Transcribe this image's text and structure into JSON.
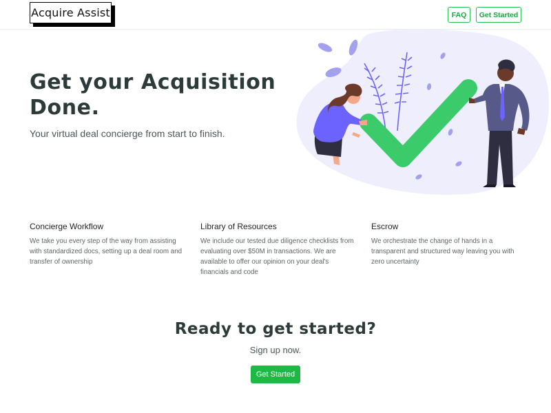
{
  "nav": {
    "logo": "Acquire Assist",
    "faq_label": "FAQ",
    "get_started_label": "Get Started"
  },
  "hero": {
    "title": "Get your Acquisition Done.",
    "subtitle": "Your virtual deal concierge from start to finish."
  },
  "features": [
    {
      "title": "Concierge Workflow",
      "description": "We take you every step of the way from assisting with standardized docs, setting up a deal room and transfer of ownership"
    },
    {
      "title": "Library of Resources",
      "description": "We include our tested due diligence checklists from evaluating over $50M in transactions. We are available to offer our opinion on your deal's financials and code"
    },
    {
      "title": "Escrow",
      "description": "We orchestrate the change of hands in a transparent and structured way leaving you with zero uncertainty"
    }
  ],
  "cta": {
    "title": "Ready to get started?",
    "subtitle": "Sign up now.",
    "button_label": "Get Started"
  },
  "colors": {
    "accent_green": "#1db944",
    "checkmark_green": "#3ccb6a",
    "blob_lavender": "#eeeefc",
    "plant_purple": "#6c63ff"
  },
  "illustration": {
    "icons": [
      "checkmark-icon",
      "woman-figure",
      "man-figure",
      "plant-leaves"
    ]
  }
}
